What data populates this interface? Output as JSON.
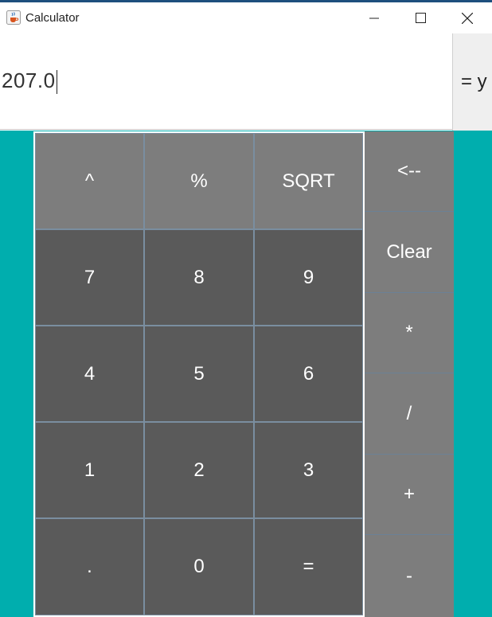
{
  "window": {
    "title": "Calculator",
    "icon": "java-cup-icon",
    "controls": [
      "minimize-icon",
      "maximize-icon",
      "close-icon"
    ]
  },
  "display": {
    "value": "207.0",
    "equals_label": "= y"
  },
  "keypad": {
    "rows": [
      [
        "^",
        "%",
        "SQRT"
      ],
      [
        "7",
        "8",
        "9"
      ],
      [
        "4",
        "5",
        "6"
      ],
      [
        "1",
        "2",
        "3"
      ],
      [
        ".",
        "0",
        "="
      ]
    ]
  },
  "operators": [
    "<--",
    "Clear",
    "*",
    "/",
    "+",
    "-"
  ],
  "colors": {
    "background": "#00aeae",
    "function_key": "#7d7d7d",
    "digit_key": "#5a5a5a",
    "operator_key": "#7d7d7d",
    "key_text": "#ffffff"
  }
}
